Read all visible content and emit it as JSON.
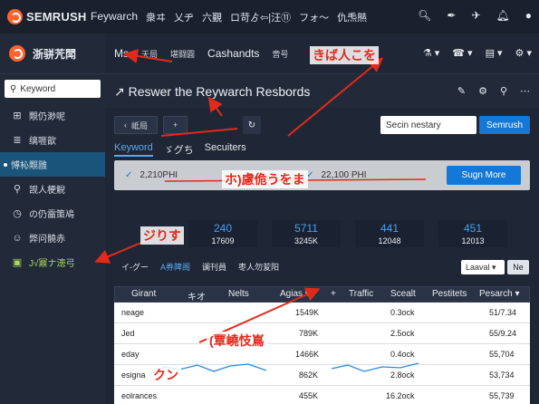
{
  "topbar": {
    "brand": "SEMRUSH",
    "nav": [
      "Feywarch",
      "衆ヰ",
      "乂ヂ",
      "六覲",
      "ロ苛ゟ⇦|汪⑪",
      "フォ〜",
      "仇𤆬㷱"
    ],
    "icons": [
      "search-icon",
      "pin-icon",
      "grid-icon",
      "bell-icon",
      "user-icon"
    ]
  },
  "sidebar": {
    "title": "浙骈苀閗",
    "search_placeholder": "Keyword",
    "items": [
      {
        "label": "覸仍渺呢",
        "icon": "grid-icon"
      },
      {
        "label": "缡啀歆",
        "icon": "doc-icon"
      },
      {
        "label": "愽杺覸雝",
        "icon": "dot-icon",
        "active": true
      },
      {
        "label": "觊人梗觬",
        "icon": "search-icon"
      },
      {
        "label": "の仍霝策鳰",
        "icon": "clock-icon"
      },
      {
        "label": "弊问髐赤",
        "icon": "face-icon"
      },
      {
        "label": "J√鼏ナ漶弓",
        "icon": "bag-icon",
        "green": true
      }
    ]
  },
  "subnav": {
    "items": [
      "Ms",
      "天局",
      "堪闘圓",
      "Cashandts",
      "啻号"
    ],
    "right_icons": [
      "link-icon",
      "phone-icon",
      "layout-icon",
      "settings-icon"
    ]
  },
  "title": "Reswer the Reywarch Resbords",
  "controls": {
    "pill1": "岻局",
    "pill2": "+",
    "search_value": "Secin nestary",
    "search_button": "Semrush"
  },
  "tabs": {
    "active": "Keyword",
    "second": "ゞグち",
    "third": "Secuiters"
  },
  "banner": {
    "left_value": "2,210РНI",
    "mid_value": "22,100 PHI",
    "button": "Sugn More"
  },
  "metrics": [
    {
      "value": "240",
      "sub": "17609"
    },
    {
      "value": "5711",
      "sub": "3245K"
    },
    {
      "value": "441",
      "sub": "12048"
    },
    {
      "value": "451",
      "sub": "12013"
    }
  ],
  "filters": [
    "イ-グー",
    "A券陴阁",
    "谰刊員",
    "枣人勿苃阳"
  ],
  "filter_select": "Laaval",
  "filter_button": "Ne",
  "table": {
    "columns": [
      "Girant",
      "キオ",
      "Nelts",
      "Agias",
      "+",
      "Traffic",
      "Scealt",
      "Pestitets",
      "Pesarch"
    ],
    "rows": [
      {
        "name": "neage",
        "val": "1549K",
        "scealt": "0.3ock",
        "pesarch": "51/7.34"
      },
      {
        "name": "Jed",
        "val": "789K",
        "scealt": "2.5ock",
        "pesarch": "55/9.24"
      },
      {
        "name": "eday",
        "val": "1466K",
        "scealt": "0.4ock",
        "pesarch": "55,704"
      },
      {
        "name": "esigna",
        "val": "862K",
        "scealt": "2.8ock",
        "pesarch": "53,734"
      },
      {
        "name": "eolrances",
        "val": "455K",
        "scealt": "16.2ock",
        "pesarch": "55,739"
      }
    ]
  },
  "annotations": {
    "a1": "きば人こを",
    "a2": "ホ)慮佹うをま",
    "a3": "ジりす",
    "a4": "(覃嶢忮嶌",
    "a5": "クン"
  },
  "colors": {
    "accent": "#1378d7",
    "brand": "#ff642d",
    "annotation": "#e22a1a"
  }
}
